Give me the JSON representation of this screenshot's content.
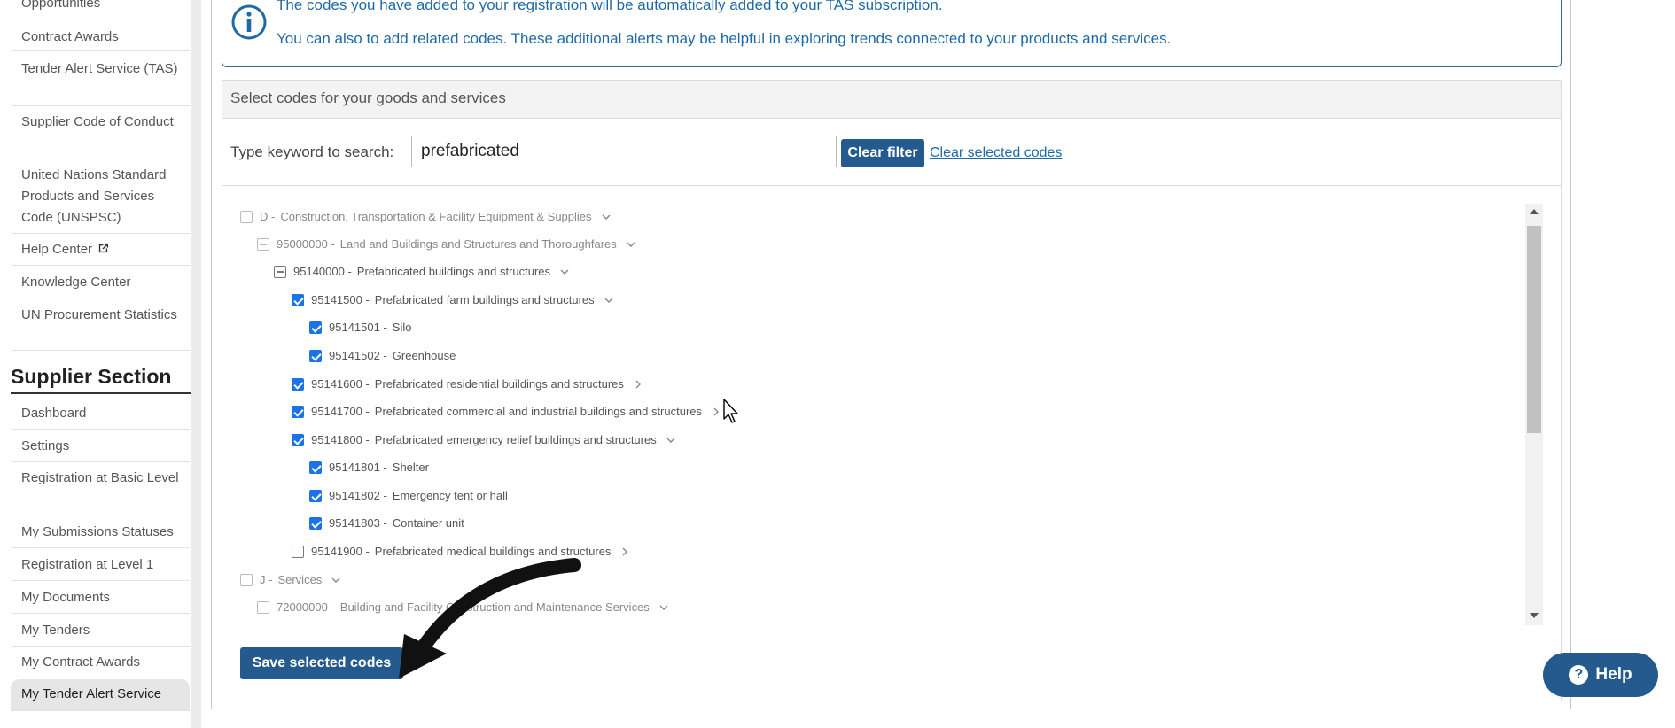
{
  "sidebar": {
    "items_top": [
      {
        "label": "Opportunities"
      },
      {
        "label": "Contract Awards"
      },
      {
        "label": "Tender Alert Service (TAS)"
      },
      {
        "label": "Supplier Code of Conduct"
      },
      {
        "label": "United Nations Standard Products and Services Code (UNSPSC)"
      },
      {
        "label": "Help Center"
      },
      {
        "label": "Knowledge Center"
      },
      {
        "label": "UN Procurement Statistics"
      }
    ],
    "supplier_section_title": "Supplier Section",
    "items_supplier": [
      {
        "label": "Dashboard"
      },
      {
        "label": "Settings"
      },
      {
        "label": "Registration at Basic Level"
      },
      {
        "label": "My Submissions Statuses"
      },
      {
        "label": "Registration at Level 1"
      },
      {
        "label": "My Documents"
      },
      {
        "label": "My Tenders"
      },
      {
        "label": "My Contract Awards"
      },
      {
        "label": "My Tender Alert Service"
      }
    ]
  },
  "info": {
    "line1": "The codes you have added to your registration will be automatically added to your TAS subscription.",
    "line2": "You can also to add related codes. These additional alerts may be helpful in exploring trends connected to your products and services."
  },
  "panel": {
    "title": "Select codes for your goods and services",
    "search_label": "Type keyword to search:",
    "search_value": "prefabricated",
    "clear_filter": "Clear filter",
    "clear_selected": "Clear selected codes",
    "save_button": "Save selected codes"
  },
  "tree": [
    {
      "code": "D -",
      "label": "Construction, Transportation & Facility Equipment & Supplies",
      "state": "unchecked-dim",
      "chevron": "down"
    },
    {
      "code": "95000000 -",
      "label": "Land and Buildings and Structures and Thoroughfares",
      "state": "partial-dim",
      "chevron": "down"
    },
    {
      "code": "95140000 -",
      "label": "Prefabricated buildings and structures",
      "state": "partial",
      "chevron": "down"
    },
    {
      "code": "95141500 -",
      "label": "Prefabricated farm buildings and structures",
      "state": "checked",
      "chevron": "down"
    },
    {
      "code": "95141501 -",
      "label": "Silo",
      "state": "checked",
      "chevron": "none"
    },
    {
      "code": "95141502 -",
      "label": "Greenhouse",
      "state": "checked",
      "chevron": "none"
    },
    {
      "code": "95141600 -",
      "label": "Prefabricated residential buildings and structures",
      "state": "checked",
      "chevron": "right"
    },
    {
      "code": "95141700 -",
      "label": "Prefabricated commercial and industrial buildings and structures",
      "state": "checked",
      "chevron": "right"
    },
    {
      "code": "95141800 -",
      "label": "Prefabricated emergency relief buildings and structures",
      "state": "checked",
      "chevron": "down"
    },
    {
      "code": "95141801 -",
      "label": "Shelter",
      "state": "checked",
      "chevron": "none"
    },
    {
      "code": "95141802 -",
      "label": "Emergency tent or hall",
      "state": "checked",
      "chevron": "none"
    },
    {
      "code": "95141803 -",
      "label": "Container unit",
      "state": "checked",
      "chevron": "none"
    },
    {
      "code": "95141900 -",
      "label": "Prefabricated medical buildings and structures",
      "state": "unchecked",
      "chevron": "right"
    },
    {
      "code": "J -",
      "label": "Services",
      "state": "unchecked-dim",
      "chevron": "down"
    },
    {
      "code": "72000000 -",
      "label": "Building and Facility Construction and Maintenance Services",
      "state": "unchecked-dim",
      "chevron": "down"
    }
  ],
  "help": {
    "label": "Help"
  },
  "colors": {
    "primary": "#255a8e",
    "info_text": "#1f6aa5",
    "checkbox": "#1a73e8"
  }
}
